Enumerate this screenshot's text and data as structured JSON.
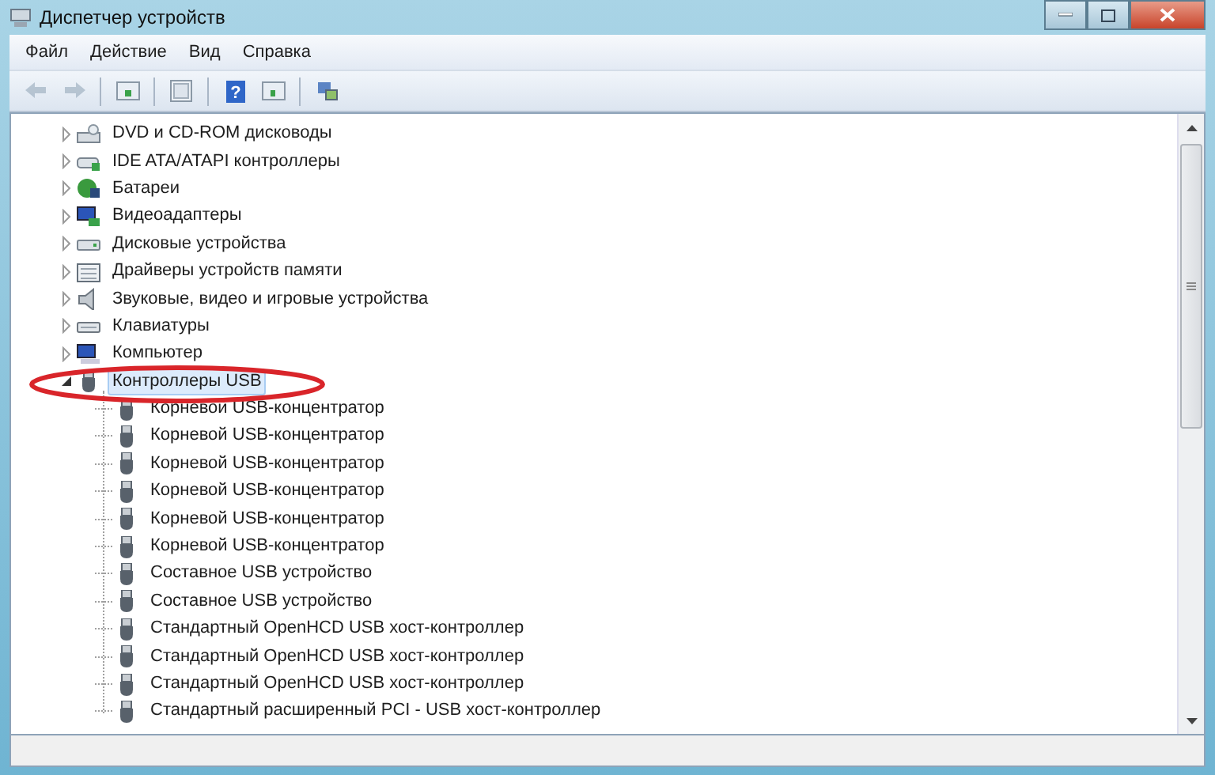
{
  "window": {
    "title": "Диспетчер устройств"
  },
  "menu": [
    "Файл",
    "Действие",
    "Вид",
    "Справка"
  ],
  "toolbar": [
    {
      "kind": "back",
      "disabled": true
    },
    {
      "kind": "forward",
      "disabled": true
    },
    {
      "kind": "sep"
    },
    {
      "kind": "properties",
      "disabled": false
    },
    {
      "kind": "sep"
    },
    {
      "kind": "console",
      "disabled": false
    },
    {
      "kind": "sep"
    },
    {
      "kind": "help",
      "disabled": false,
      "label": "?"
    },
    {
      "kind": "panel",
      "disabled": false
    },
    {
      "kind": "sep"
    },
    {
      "kind": "scan",
      "disabled": false
    }
  ],
  "tree": [
    {
      "label": "DVD и CD-ROM дисководы",
      "kind": "drive",
      "expanded": false,
      "selected": false
    },
    {
      "label": "IDE ATA/ATAPI контроллеры",
      "kind": "controller",
      "expanded": false,
      "selected": false
    },
    {
      "label": "Батареи",
      "kind": "battery",
      "expanded": false,
      "selected": false
    },
    {
      "label": "Видеоадаптеры",
      "kind": "display",
      "expanded": false,
      "selected": false
    },
    {
      "label": "Дисковые устройства",
      "kind": "disk",
      "expanded": false,
      "selected": false
    },
    {
      "label": "Драйверы устройств памяти",
      "kind": "memory",
      "expanded": false,
      "selected": false
    },
    {
      "label": "Звуковые, видео и игровые устройства",
      "kind": "sound",
      "expanded": false,
      "selected": false
    },
    {
      "label": "Клавиатуры",
      "kind": "keyboard",
      "expanded": false,
      "selected": false
    },
    {
      "label": "Компьютер",
      "kind": "computer",
      "expanded": false,
      "selected": false
    },
    {
      "label": "Контроллеры USB",
      "kind": "usb",
      "expanded": true,
      "selected": true,
      "children": [
        {
          "label": "Корневой USB-концентратор",
          "kind": "usb",
          "selected": false
        },
        {
          "label": "Корневой USB-концентратор",
          "kind": "usb",
          "selected": false
        },
        {
          "label": "Корневой USB-концентратор",
          "kind": "usb",
          "selected": false
        },
        {
          "label": "Корневой USB-концентратор",
          "kind": "usb",
          "selected": false
        },
        {
          "label": "Корневой USB-концентратор",
          "kind": "usb",
          "selected": false
        },
        {
          "label": "Корневой USB-концентратор",
          "kind": "usb",
          "selected": false
        },
        {
          "label": "Составное USB устройство",
          "kind": "usb",
          "selected": false
        },
        {
          "label": "Составное USB устройство",
          "kind": "usb",
          "selected": false
        },
        {
          "label": "Стандартный OpenHCD USB хост-контроллер",
          "kind": "usb",
          "selected": false
        },
        {
          "label": "Стандартный OpenHCD USB хост-контроллер",
          "kind": "usb",
          "selected": false
        },
        {
          "label": "Стандартный OpenHCD USB хост-контроллер",
          "kind": "usb",
          "selected": false
        },
        {
          "label": "Стандартный расширенный PCI - USB хост-контроллер",
          "kind": "usb",
          "selected": false
        }
      ]
    }
  ]
}
